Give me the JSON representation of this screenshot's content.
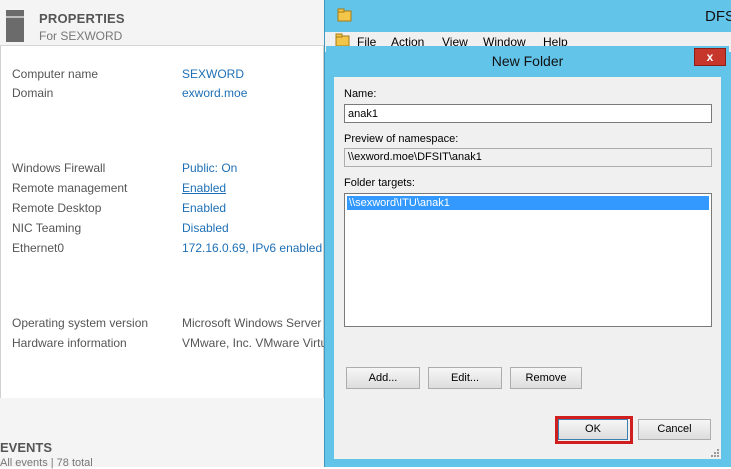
{
  "server_manager": {
    "header": {
      "title": "PROPERTIES",
      "subtitle": "For SEXWORD"
    },
    "properties": [
      {
        "label": "Computer name",
        "value": "SEXWORD",
        "style": "link"
      },
      {
        "label": "Domain",
        "value": "exword.moe",
        "style": "link"
      },
      {
        "label": "Windows Firewall",
        "value": "Public: On",
        "style": "link"
      },
      {
        "label": "Remote management",
        "value": "Enabled",
        "style": "link-underline"
      },
      {
        "label": "Remote Desktop",
        "value": "Enabled",
        "style": "link"
      },
      {
        "label": "NIC Teaming",
        "value": "Disabled",
        "style": "link"
      },
      {
        "label": "Ethernet0",
        "value": "172.16.0.69, IPv6 enabled",
        "style": "link"
      },
      {
        "label": "Operating system version",
        "value": "Microsoft Windows Server",
        "style": "plain"
      },
      {
        "label": "Hardware information",
        "value": "VMware, Inc. VMware Virtu",
        "style": "plain"
      }
    ],
    "events": {
      "title": "EVENTS",
      "subtitle": "All events | 78 total"
    }
  },
  "dfs_window": {
    "title": "DFS",
    "menu": [
      "File",
      "Action",
      "View",
      "Window",
      "Help"
    ]
  },
  "dialog": {
    "title": "New Folder",
    "close_label": "x",
    "name_label": "Name:",
    "name_value": "anak1",
    "preview_label": "Preview of namespace:",
    "preview_value": "\\\\exword.moe\\DFSIT\\anak1",
    "targets_label": "Folder targets:",
    "targets": [
      "\\\\sexword\\ITU\\anak1"
    ],
    "buttons": {
      "add": "Add...",
      "edit": "Edit...",
      "remove": "Remove",
      "ok": "OK",
      "cancel": "Cancel"
    }
  },
  "colors": {
    "window_frame": "#63c4ea",
    "link": "#1e6fb5",
    "selection": "#3399ff",
    "close_button": "#c7362b",
    "highlight_box": "#d01d1d"
  }
}
